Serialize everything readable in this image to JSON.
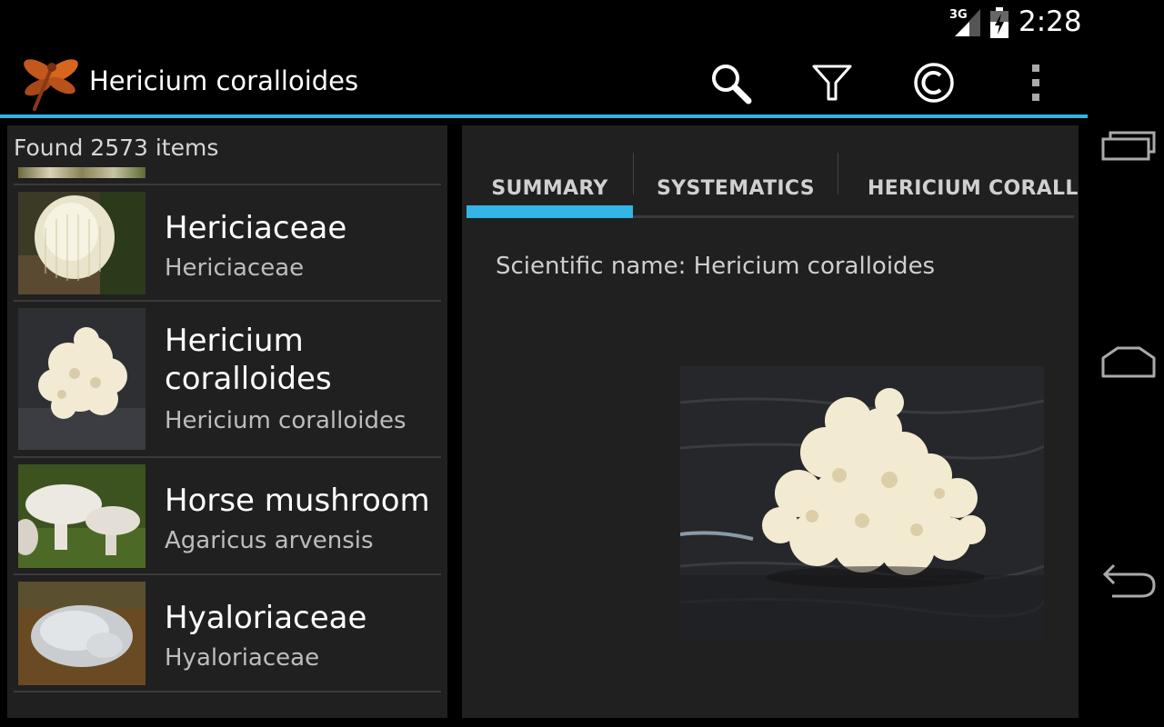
{
  "status_bar": {
    "network": "3G",
    "time": "2:28",
    "icons": [
      "signal-icon",
      "battery-charging-icon"
    ]
  },
  "action_bar": {
    "title": "Hericium coralloides",
    "logo": "dragonfly-logo-icon",
    "actions": [
      "search-icon",
      "filter-icon",
      "copyright-icon",
      "overflow-menu-icon"
    ],
    "accent_color": "#33b5e5"
  },
  "list": {
    "count_label": "Found 2573 items",
    "items": [
      {
        "title": "Hericiaceae",
        "subtitle": "Hericiaceae",
        "thumbnail": "lions-mane-fungus-photo"
      },
      {
        "title": "Hericium coralloides",
        "subtitle": "Hericium coralloides",
        "thumbnail": "coral-tooth-fungus-photo"
      },
      {
        "title": "Horse mushroom",
        "subtitle": "Agaricus arvensis",
        "thumbnail": "horse-mushroom-photo"
      },
      {
        "title": "Hyaloriaceae",
        "subtitle": "Hyaloriaceae",
        "thumbnail": "jelly-fungus-photo"
      }
    ]
  },
  "detail": {
    "tabs": [
      "SUMMARY",
      "SYSTEMATICS",
      "HERICIUM CORALLOI"
    ],
    "active_tab": "SUMMARY",
    "scientific_name_label": "Scientific name: Hericium coralloides",
    "image": "hericium-coralloides-photo"
  },
  "nav_bar": {
    "buttons": [
      "recent-apps-icon",
      "home-icon",
      "back-icon"
    ]
  }
}
